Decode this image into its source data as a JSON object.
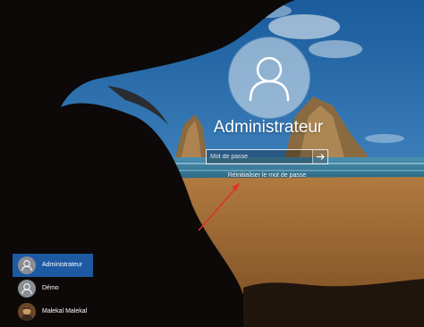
{
  "login": {
    "username": "Administrateur",
    "password_placeholder": "Mot de passe",
    "reset_link": "Réinitialiser le mot de passe"
  },
  "users": [
    {
      "name": "Administrateur",
      "selected": true,
      "avatar": "user-icon"
    },
    {
      "name": "Démo",
      "selected": false,
      "avatar": "user-icon"
    },
    {
      "name": "Malekal Malekal",
      "selected": false,
      "avatar": "profile-photo"
    }
  ],
  "colors": {
    "selected_user": "#1d5aa3",
    "annotation_arrow": "#e0302a",
    "avatar_circle": "#e6ecf2"
  },
  "icons": {
    "submit": "arrow-right-icon",
    "avatar": "user-icon"
  }
}
